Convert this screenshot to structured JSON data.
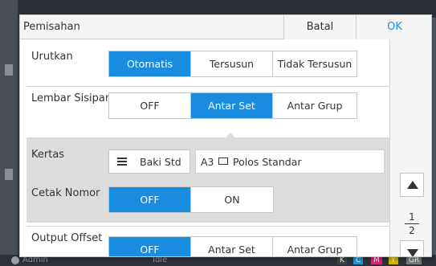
{
  "dialog": {
    "title": "Pemisahan",
    "cancel_label": "Batal",
    "ok_label": "OK"
  },
  "sort": {
    "label": "Urutkan",
    "options": [
      "Otomatis",
      "Tersusun",
      "Tidak Tersusun"
    ],
    "selected": "Otomatis"
  },
  "insert_sheet": {
    "label": "Lembar Sisipan",
    "options": [
      "OFF",
      "Antar Set",
      "Antar Grup"
    ],
    "selected": "Antar Set"
  },
  "paper": {
    "label": "Kertas",
    "tray_label": "Baki Std",
    "size": "A3",
    "type": "Polos Standar"
  },
  "print_number": {
    "label": "Cetak Nomor",
    "options": [
      "OFF",
      "ON"
    ],
    "selected": "OFF"
  },
  "output_offset": {
    "label": "Output Offset",
    "options": [
      "OFF",
      "Antar Set",
      "Antar Grup"
    ],
    "selected": "OFF"
  },
  "pager": {
    "current": "1",
    "total": "2"
  },
  "status_bar": {
    "user": "Admin",
    "state": "Idle",
    "inks": [
      "K",
      "C",
      "M",
      "Y",
      "GR"
    ]
  },
  "colors": {
    "accent": "#1a8ce0",
    "selected_text": "#ffffff",
    "sub_panel": "#dcdcdc"
  }
}
